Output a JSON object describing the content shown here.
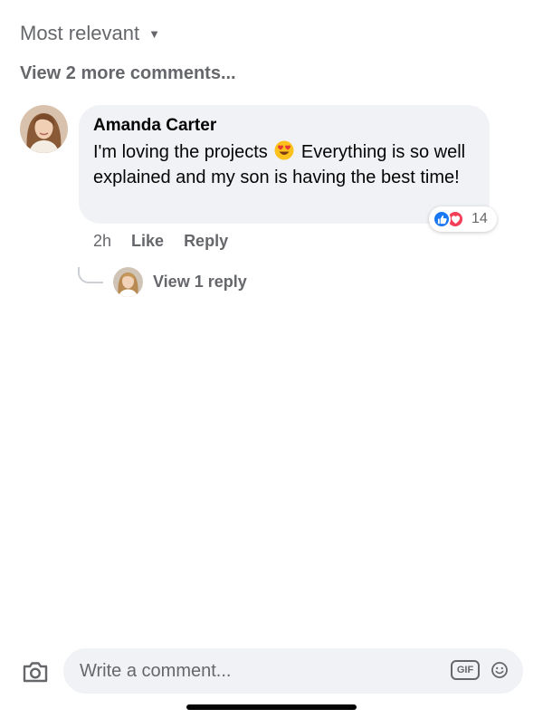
{
  "sort": {
    "label": "Most relevant",
    "caret_icon": "caret-down-icon"
  },
  "more_comments": {
    "label": "View 2 more comments..."
  },
  "comment": {
    "author": "Amanda Carter",
    "text_before_emoji": "I'm loving the projects",
    "emoji": "heart-eyes-emoji",
    "text_after_emoji": "Everything is so well explained and my son is having the best time!",
    "reactions": {
      "types": [
        "like",
        "love"
      ],
      "count": "14"
    },
    "time": "2h",
    "like_label": "Like",
    "reply_label": "Reply"
  },
  "replies": {
    "label": "View 1 reply"
  },
  "composer": {
    "placeholder": "Write a comment...",
    "gif_label": "GIF",
    "camera_icon": "camera-icon",
    "emoji_icon": "smiley-icon"
  },
  "colors": {
    "bubble_bg": "#f0f2f5",
    "secondary_text": "#65676b",
    "like_blue": "#1877f2",
    "love_red": "#f33e58"
  }
}
